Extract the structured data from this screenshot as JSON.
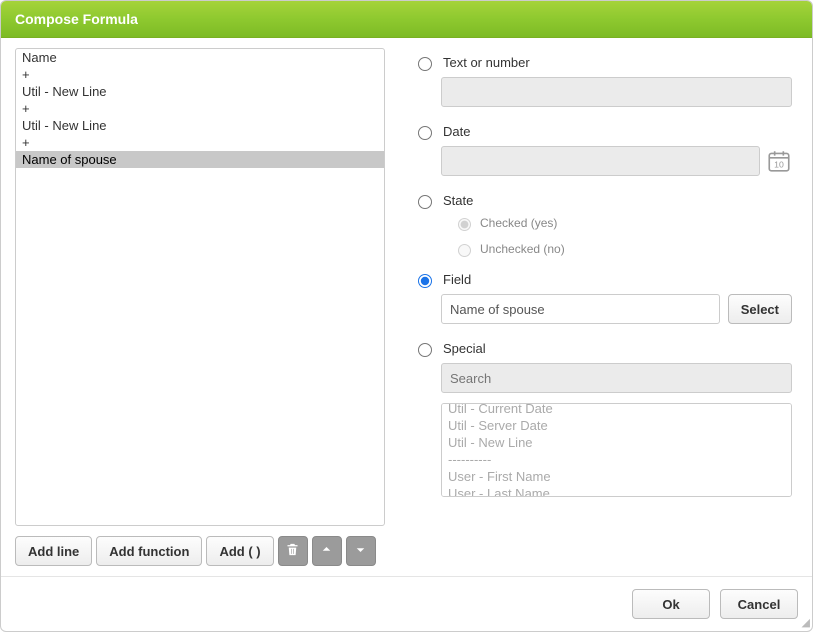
{
  "title": "Compose Formula",
  "formula_lines": [
    {
      "text": "Name",
      "selected": false
    },
    {
      "text": "+",
      "selected": false
    },
    {
      "text": "Util - New Line",
      "selected": false
    },
    {
      "text": "+",
      "selected": false
    },
    {
      "text": "Util - New Line",
      "selected": false
    },
    {
      "text": "+",
      "selected": false
    },
    {
      "text": "Name of spouse",
      "selected": true
    }
  ],
  "left_buttons": {
    "add_line": "Add line",
    "add_function": "Add function",
    "add_paren": "Add ( )"
  },
  "type_options": {
    "text_or_number": {
      "label": "Text or number",
      "checked": false,
      "value": ""
    },
    "date": {
      "label": "Date",
      "checked": false,
      "value": ""
    },
    "state": {
      "label": "State",
      "checked": false,
      "checked_label": "Checked (yes)",
      "unchecked_label": "Unchecked (no)",
      "sub_selected": "checked"
    },
    "field": {
      "label": "Field",
      "checked": true,
      "value": "Name of spouse",
      "select_btn": "Select"
    },
    "special": {
      "label": "Special",
      "checked": false,
      "search_placeholder": "Search"
    }
  },
  "special_items": [
    "Util - Current Date",
    "Util - Server Date",
    "Util - New Line",
    "----------",
    "User - First Name",
    "User - Last Name"
  ],
  "calendar_day": "10",
  "footer": {
    "ok": "Ok",
    "cancel": "Cancel"
  }
}
